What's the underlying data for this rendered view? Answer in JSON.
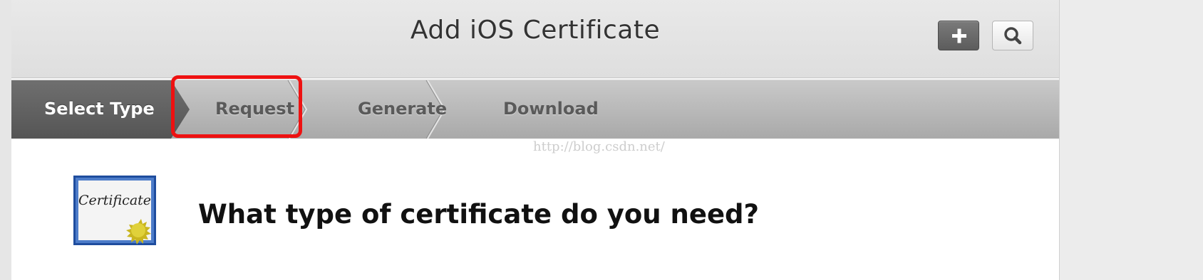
{
  "header": {
    "title": "Add iOS Certificate",
    "add_icon": "plus-icon",
    "search_icon": "search-icon"
  },
  "steps": [
    {
      "label": "Select Type",
      "active": true
    },
    {
      "label": "Request",
      "active": false
    },
    {
      "label": "Generate",
      "active": false
    },
    {
      "label": "Download",
      "active": false
    }
  ],
  "watermark": "http://blog.csdn.net/",
  "content": {
    "certificate_icon_text": "Certificate",
    "question": "What type of certificate do you need?"
  },
  "colors": {
    "highlight": "#ee1111",
    "active_step": "#5f5f5f",
    "certificate_border": "#1f4d9e",
    "seal": "#d4c22a"
  }
}
